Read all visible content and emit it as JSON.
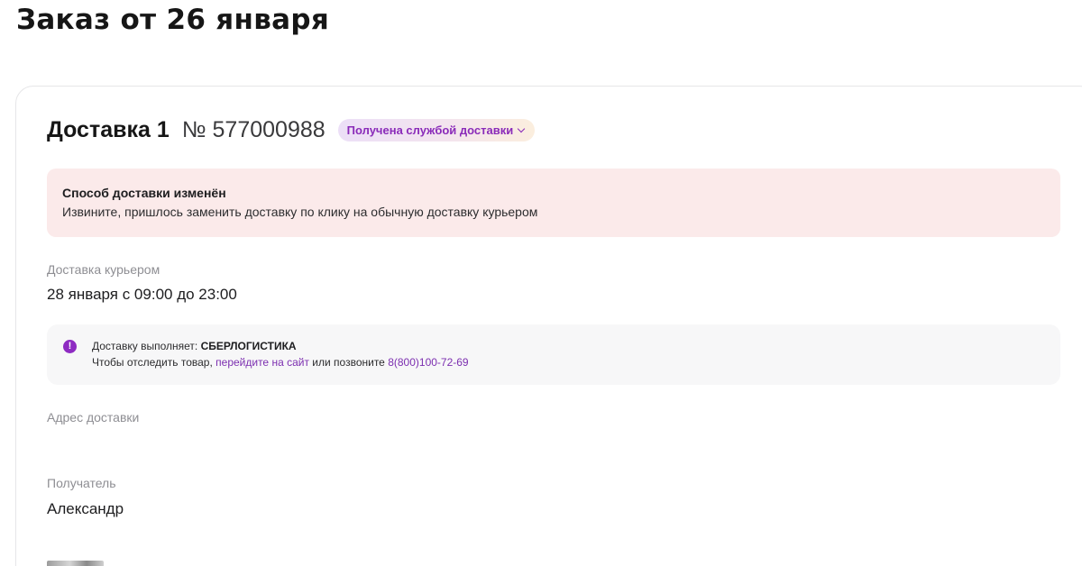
{
  "page": {
    "title": "Заказ от 26 января"
  },
  "delivery": {
    "title": "Доставка 1",
    "number": "№ 577000988",
    "status": "Получена службой доставки",
    "status_colors": {
      "text": "#8a2bb9",
      "background_start": "#ecdff7",
      "background_end": "#fbeede"
    }
  },
  "alert": {
    "title": "Способ доставки изменён",
    "text": "Извините, пришлось заменить доставку по клику на обычную доставку курьером",
    "background": "#fbeaea"
  },
  "delivery_method": {
    "label": "Доставка курьером",
    "value": "28 января с 09:00 до 23:00"
  },
  "carrier": {
    "icon": "exclamation-info-icon",
    "prefix": "Доставку выполняет:",
    "name": "СБЕРЛОГИСТИКА",
    "track_prefix": "Чтобы отследить товар,",
    "track_link": "перейдите на сайт",
    "call_text": "или позвоните",
    "phone": "8(800)100-72-69",
    "accent": "#8e2bc2"
  },
  "address": {
    "label": "Адрес доставки"
  },
  "recipient": {
    "label": "Получатель",
    "name": "Александр"
  }
}
